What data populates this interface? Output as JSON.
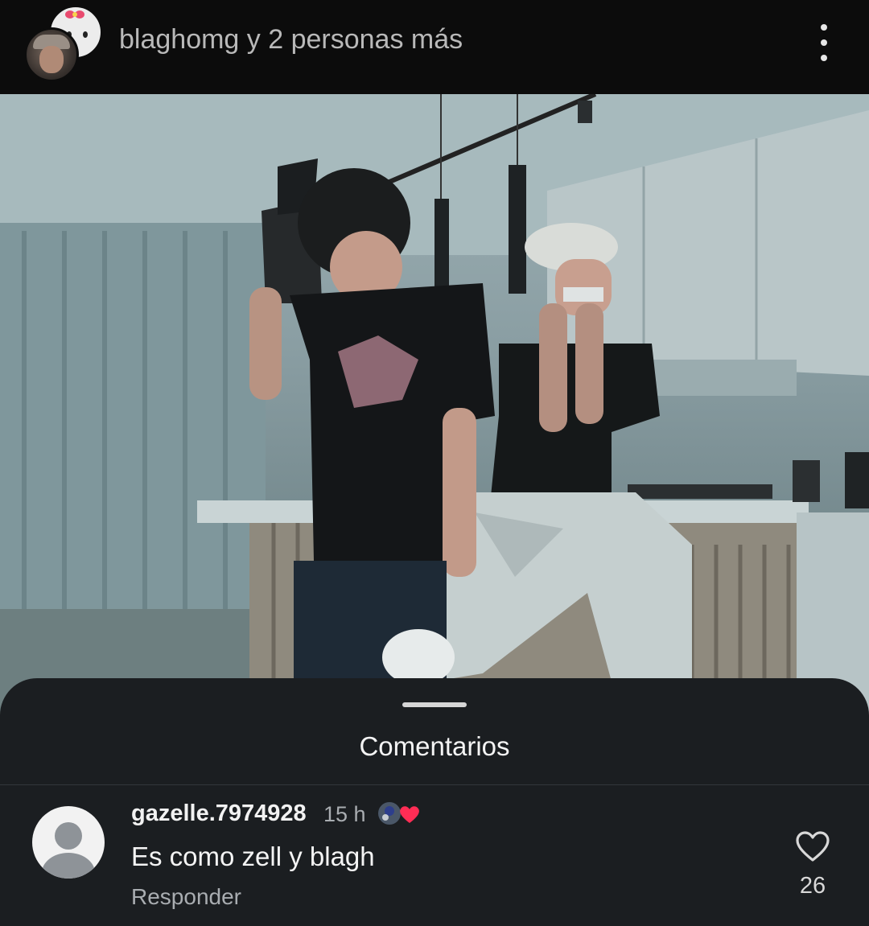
{
  "header": {
    "title": "blaghomg y 2 personas más",
    "more_icon": "more-vertical-icon"
  },
  "sheet": {
    "title": "Comentarios"
  },
  "comment": {
    "username": "gazelle.7974928",
    "time": "15 h",
    "text": "Es como zell y blagh",
    "reply_label": "Responder",
    "likes": "26",
    "like_icon": "heart-outline-icon",
    "badge_icon": "liked-by-author-badge"
  },
  "colors": {
    "header_bg": "#0c0c0c",
    "sheet_bg": "#1b1e21",
    "secondary_text": "#a9adb1",
    "heart_red": "#ff2d55"
  }
}
